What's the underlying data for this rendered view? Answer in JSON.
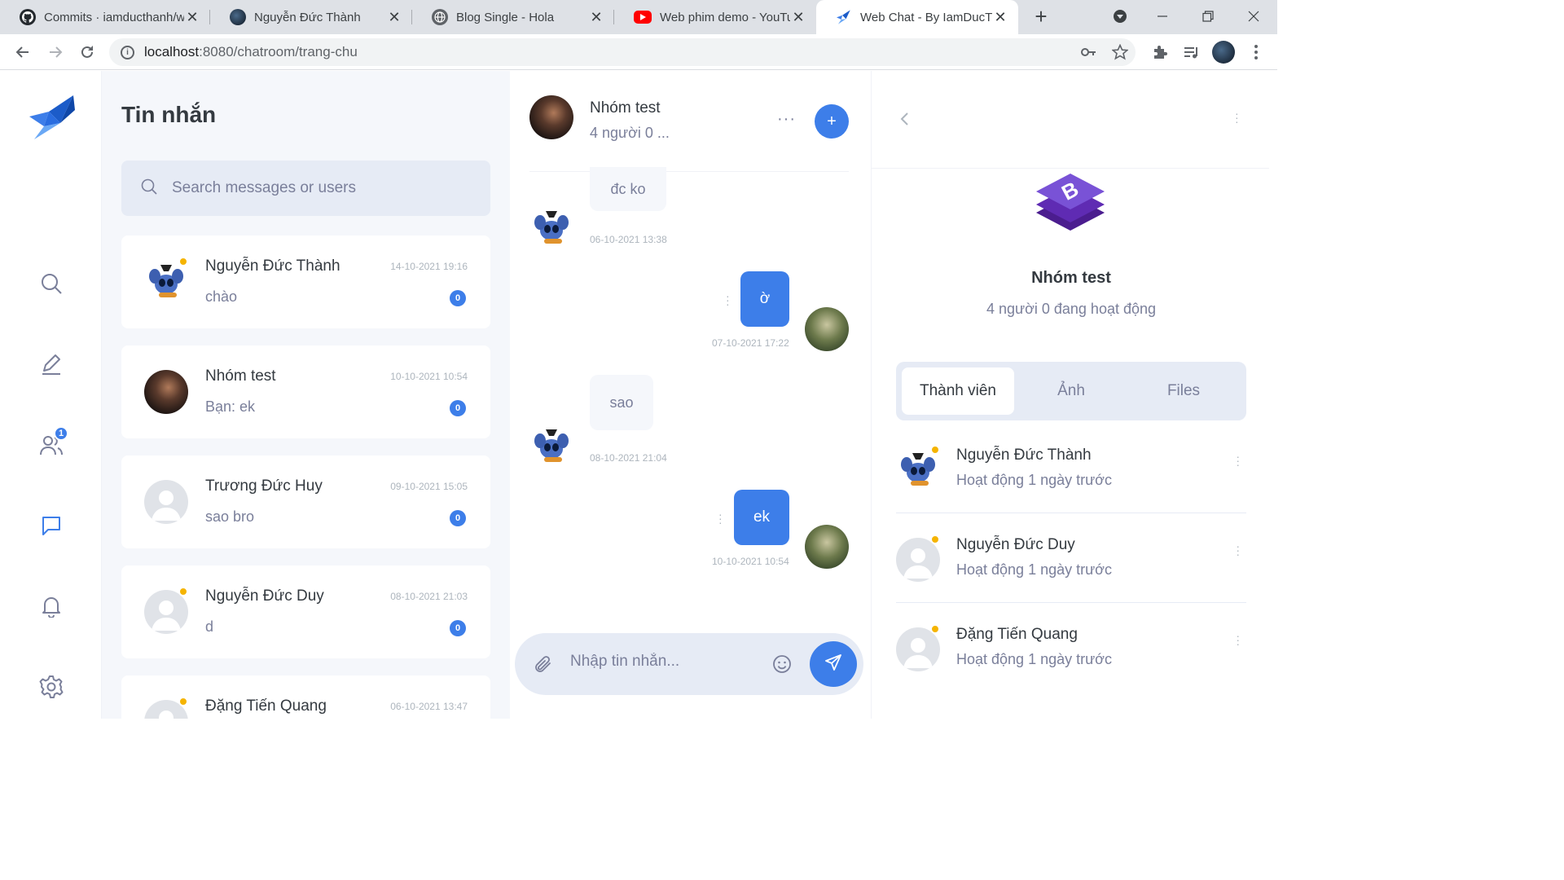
{
  "browser": {
    "tabs": [
      {
        "title": "Commits · iamducthanh/w",
        "icon": "github-icon"
      },
      {
        "title": "Nguyễn Đức Thành",
        "icon": "profile-icon"
      },
      {
        "title": "Blog Single - Hola",
        "icon": "globe-icon"
      },
      {
        "title": "Web phim demo - YouTub",
        "icon": "youtube-icon"
      },
      {
        "title": "Web Chat - By IamDucTha",
        "icon": "bird-icon"
      }
    ],
    "url_host": "localhost",
    "url_path": ":8080/chatroom/trang-chu"
  },
  "sidebar": {
    "items": [
      {
        "name": "search-icon"
      },
      {
        "name": "pencil-icon"
      },
      {
        "name": "users-icon",
        "badge": "1"
      },
      {
        "name": "chat-icon"
      },
      {
        "name": "bell-icon"
      },
      {
        "name": "gear-icon"
      }
    ]
  },
  "conversations": {
    "title": "Tin nhắn",
    "search_placeholder": "Search messages or users",
    "items": [
      {
        "name": "Nguyễn Đức Thành",
        "preview": "chào",
        "time": "14-10-2021 19:16",
        "unread": "0"
      },
      {
        "name": "Nhóm test",
        "preview": "Bạn: ek",
        "time": "10-10-2021 10:54",
        "unread": "0"
      },
      {
        "name": "Trương Đức Huy",
        "preview": "sao bro",
        "time": "09-10-2021 15:05",
        "unread": "0"
      },
      {
        "name": "Nguyễn Đức Duy",
        "preview": "d",
        "time": "08-10-2021 21:03",
        "unread": "0"
      },
      {
        "name": "Đặng Tiến Quang",
        "preview": "",
        "time": "06-10-2021 13:47",
        "unread": ""
      }
    ]
  },
  "chat": {
    "title": "Nhóm test",
    "subtitle": "4 người 0 ...",
    "more": "···",
    "plus": "+",
    "messages": [
      {
        "text": "đc ko",
        "time": "06-10-2021 13:38",
        "direction": "in"
      },
      {
        "text": "ờ",
        "time": "07-10-2021 17:22",
        "direction": "out"
      },
      {
        "text": "sao",
        "time": "08-10-2021 21:04",
        "direction": "in"
      },
      {
        "text": "ek",
        "time": "10-10-2021 10:54",
        "direction": "out"
      }
    ],
    "input_placeholder": "Nhập tin nhắn..."
  },
  "info": {
    "group_name": "Nhóm test",
    "group_status": "4 người 0 đang hoạt động",
    "tabs": [
      "Thành viên",
      "Ảnh",
      "Files"
    ],
    "members": [
      {
        "name": "Nguyễn Đức Thành",
        "status": "Hoạt động 1 ngày trước"
      },
      {
        "name": "Nguyễn Đức Duy",
        "status": "Hoạt động 1 ngày trước"
      },
      {
        "name": "Đặng Tiến Quang",
        "status": "Hoạt động 1 ngày trước"
      }
    ]
  },
  "colors": {
    "accent": "#3d7ee9",
    "panel_bg": "#f5f7fb",
    "input_bg": "#e6ebf5",
    "online_dot": "#f5b400",
    "muted_text": "#7a7f9a"
  }
}
